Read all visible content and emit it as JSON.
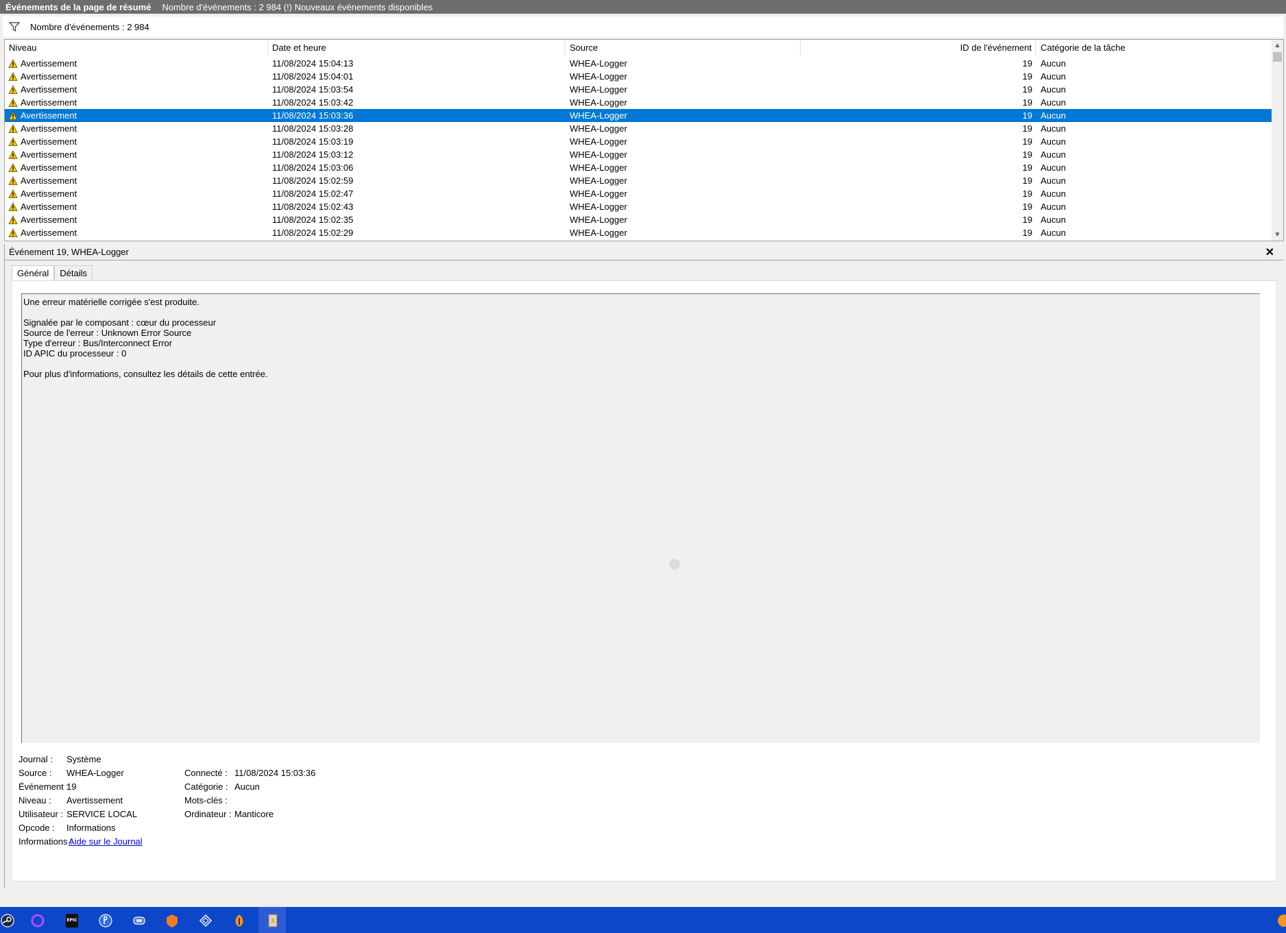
{
  "titlebar": {
    "title": "Événements de la page de résumé",
    "status": "Nombre d'événements : 2 984 (!) Nouveaux événements disponibles"
  },
  "filterbar": {
    "count": "Nombre d'événements : 2 984"
  },
  "grid": {
    "columns": {
      "level": "Niveau",
      "date": "Date et heure",
      "source": "Source",
      "id": "ID de l'événement",
      "category": "Catégorie de la tâche"
    },
    "rows": [
      {
        "level": "Avertissement",
        "date": "11/08/2024 15:04:13",
        "source": "WHEA-Logger",
        "id": "19",
        "category": "Aucun"
      },
      {
        "level": "Avertissement",
        "date": "11/08/2024 15:04:01",
        "source": "WHEA-Logger",
        "id": "19",
        "category": "Aucun"
      },
      {
        "level": "Avertissement",
        "date": "11/08/2024 15:03:54",
        "source": "WHEA-Logger",
        "id": "19",
        "category": "Aucun"
      },
      {
        "level": "Avertissement",
        "date": "11/08/2024 15:03:42",
        "source": "WHEA-Logger",
        "id": "19",
        "category": "Aucun"
      },
      {
        "level": "Avertissement",
        "date": "11/08/2024 15:03:36",
        "source": "WHEA-Logger",
        "id": "19",
        "category": "Aucun"
      },
      {
        "level": "Avertissement",
        "date": "11/08/2024 15:03:28",
        "source": "WHEA-Logger",
        "id": "19",
        "category": "Aucun"
      },
      {
        "level": "Avertissement",
        "date": "11/08/2024 15:03:19",
        "source": "WHEA-Logger",
        "id": "19",
        "category": "Aucun"
      },
      {
        "level": "Avertissement",
        "date": "11/08/2024 15:03:12",
        "source": "WHEA-Logger",
        "id": "19",
        "category": "Aucun"
      },
      {
        "level": "Avertissement",
        "date": "11/08/2024 15:03:06",
        "source": "WHEA-Logger",
        "id": "19",
        "category": "Aucun"
      },
      {
        "level": "Avertissement",
        "date": "11/08/2024 15:02:59",
        "source": "WHEA-Logger",
        "id": "19",
        "category": "Aucun"
      },
      {
        "level": "Avertissement",
        "date": "11/08/2024 15:02:47",
        "source": "WHEA-Logger",
        "id": "19",
        "category": "Aucun"
      },
      {
        "level": "Avertissement",
        "date": "11/08/2024 15:02:43",
        "source": "WHEA-Logger",
        "id": "19",
        "category": "Aucun"
      },
      {
        "level": "Avertissement",
        "date": "11/08/2024 15:02:35",
        "source": "WHEA-Logger",
        "id": "19",
        "category": "Aucun"
      },
      {
        "level": "Avertissement",
        "date": "11/08/2024 15:02:29",
        "source": "WHEA-Logger",
        "id": "19",
        "category": "Aucun"
      }
    ],
    "selected_index": 4
  },
  "detail": {
    "header": "Événement 19, WHEA-Logger",
    "tabs": [
      "Général",
      "Détails"
    ],
    "message": "Une erreur matérielle corrigée s'est produite.\n\nSignalée par le composant : cœur du processeur\nSource de l'erreur : Unknown Error Source\nType d'erreur : Bus/Interconnect Error\nID APIC du processeur : 0\n\nPour plus d'informations, consultez les détails de cette entrée.",
    "props": {
      "journal_label": "Journal :",
      "journal": "Système",
      "source_label": "Source :",
      "source": "WHEA-Logger",
      "logged_label": "Connecté :",
      "logged": "11/08/2024 15:03:36",
      "event_label": "Événement :",
      "event": "19",
      "category_label": "Catégorie :",
      "category": "Aucun",
      "level_label": "Niveau :",
      "level": "Avertissement",
      "keywords_label": "Mots-clés :",
      "keywords": "",
      "user_label": "Utilisateur :",
      "user": "SERVICE LOCAL",
      "computer_label": "Ordinateur :",
      "computer": "Manticore",
      "opcode_label": "Opcode :",
      "opcode": "Informations",
      "info_label": "Informations :",
      "info_link": "Aide sur le Journal"
    }
  },
  "taskbar": {
    "icons": [
      "steam-icon",
      "cortana-ring-icon",
      "epic-games-icon",
      "playstation-icon",
      "controller-icon",
      "bitdefender-icon",
      "network-icon",
      "fl-studio-icon",
      "event-viewer-icon",
      "notification-icon"
    ],
    "accent": "#0d47c9"
  }
}
